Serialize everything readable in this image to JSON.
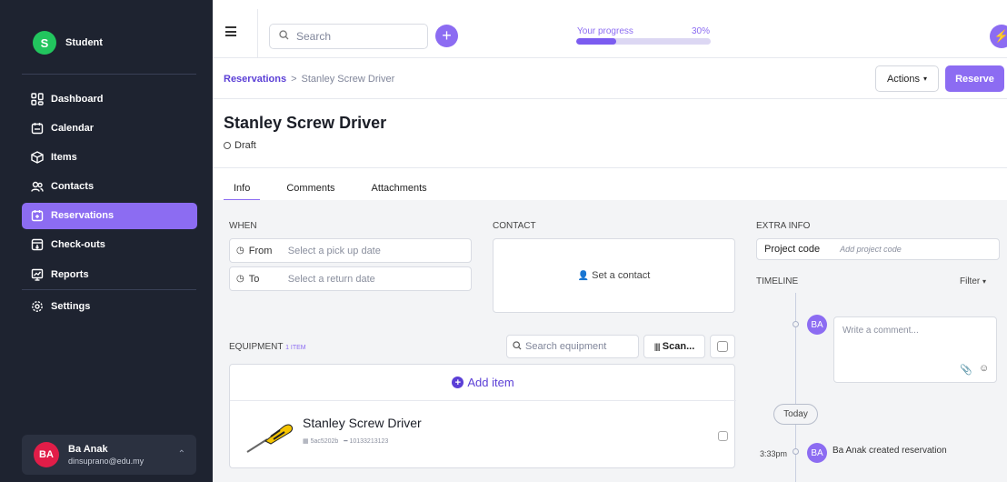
{
  "sidebar": {
    "brand": {
      "initial": "S",
      "name": "Student"
    },
    "items": [
      {
        "label": "Dashboard",
        "icon": "dashboard-icon"
      },
      {
        "label": "Calendar",
        "icon": "calendar-icon"
      },
      {
        "label": "Items",
        "icon": "cube-icon"
      },
      {
        "label": "Contacts",
        "icon": "contacts-icon"
      },
      {
        "label": "Reservations",
        "icon": "reservation-icon",
        "active": true
      },
      {
        "label": "Check-outs",
        "icon": "checkout-icon"
      },
      {
        "label": "Reports",
        "icon": "reports-icon"
      }
    ],
    "settings": {
      "label": "Settings",
      "icon": "gear-icon"
    },
    "user": {
      "initials": "BA",
      "name": "Ba Anak",
      "email": "dinsuprano@edu.my"
    }
  },
  "topbar": {
    "search_placeholder": "Search",
    "progress_label": "Your progress",
    "progress_value": "30%",
    "progress_fraction": 0.3
  },
  "breadcrumb": {
    "root": "Reservations",
    "current": "Stanley Screw Driver"
  },
  "header": {
    "actions_label": "Actions",
    "reserve_label": "Reserve",
    "title": "Stanley Screw Driver",
    "status": "Draft"
  },
  "tabs": [
    "Info",
    "Comments",
    "Attachments"
  ],
  "when": {
    "label": "WHEN",
    "from_label": "From",
    "from_placeholder": "Select a pick up date",
    "to_label": "To",
    "to_placeholder": "Select a return date"
  },
  "contact": {
    "label": "CONTACT",
    "set_label": "Set a contact"
  },
  "extra": {
    "label": "EXTRA INFO",
    "project_label": "Project code",
    "project_placeholder": "Add project code"
  },
  "timeline": {
    "label": "TIMELINE",
    "filter_label": "Filter",
    "comment_initials": "BA",
    "comment_placeholder": "Write a comment...",
    "today_label": "Today",
    "event_time": "3:33pm",
    "event_initials": "BA",
    "event_text": "Ba Anak created reservation"
  },
  "equipment": {
    "label": "EQUIPMENT",
    "count": "1 ITEM",
    "search_placeholder": "Search equipment",
    "scan_label": "Scan...",
    "add_label": "Add item",
    "item_name": "Stanley Screw Driver",
    "item_code": "5ac5202b",
    "item_barcode": "10133213123"
  },
  "colors": {
    "accent": "#8c6cf2",
    "sidebar": "#1e2330",
    "brand": "#22c55e",
    "avatar": "#e11d48"
  }
}
